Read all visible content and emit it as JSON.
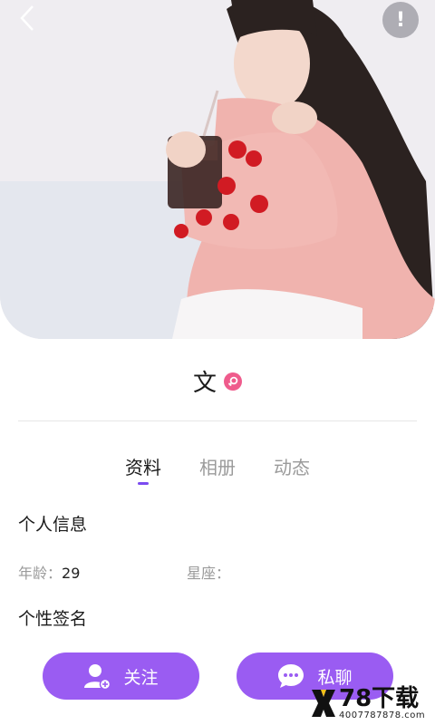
{
  "profile": {
    "name": "文",
    "gender_icon": "female-symbol-icon"
  },
  "tabs": [
    {
      "label": "资料",
      "active": true
    },
    {
      "label": "相册",
      "active": false
    },
    {
      "label": "动态",
      "active": false
    }
  ],
  "personal_info": {
    "title": "个人信息",
    "age_label": "年龄：",
    "age_value": "29",
    "zodiac_label": "星座：",
    "zodiac_value": ""
  },
  "signature": {
    "title": "个性签名"
  },
  "actions": {
    "follow_label": "关注",
    "chat_label": "私聊"
  },
  "header": {
    "report_label": "!"
  },
  "watermark": {
    "brand_main": "78下载",
    "brand_sub": "4007787878.com"
  },
  "colors": {
    "accent": "#9a5cf2",
    "tab_indicator": "#7b4bf0",
    "gender_badge": "#ef5b8c"
  }
}
